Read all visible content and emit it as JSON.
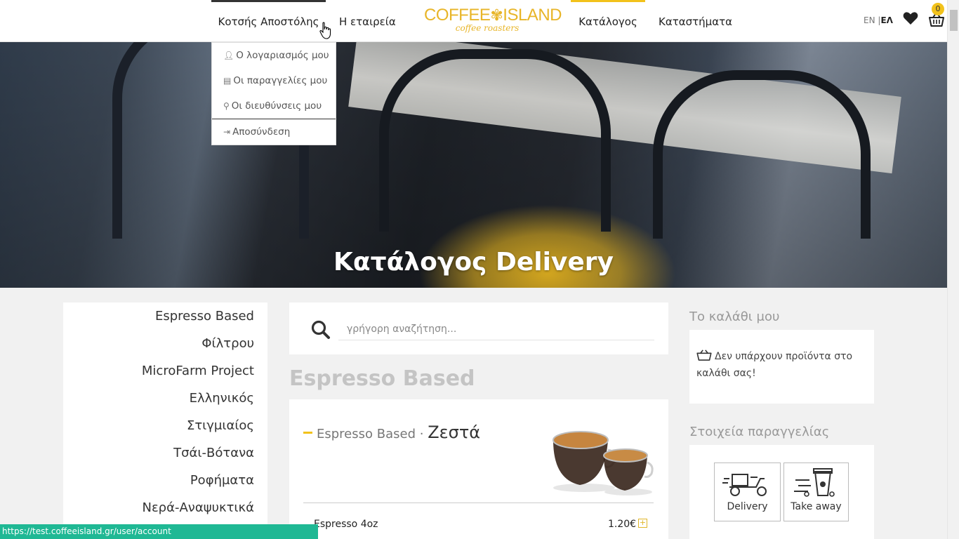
{
  "header": {
    "user_label": "Κοτσής Αποστόλης",
    "company_label": "Η εταιρεία",
    "catalog_label": "Κατάλογος",
    "stores_label": "Καταστήματα",
    "logo_brand_left": "COFFEE",
    "logo_brand_right": "ISLAND",
    "logo_sub": "coffee roasters",
    "lang_en": "EN",
    "lang_sep": "|",
    "lang_el": "ΕΛ",
    "cart_count": "0",
    "accent_color": "#f2c21b"
  },
  "user_menu": {
    "items": [
      {
        "icon": "user-icon",
        "label": "Ο λογαριασμός μου"
      },
      {
        "icon": "document-icon",
        "label": "Οι παραγγελίες μου"
      },
      {
        "icon": "map-marker-icon",
        "label": "Οι διευθύνσεις μου"
      },
      {
        "icon": "sign-out-icon",
        "label": "Αποσύνδεση"
      }
    ]
  },
  "hero": {
    "title": "Κατάλογος Delivery"
  },
  "sidebar": {
    "categories": [
      "Espresso Based",
      "Φίλτρου",
      "MicroFarm Project",
      "Ελληνικός",
      "Στιγμιαίος",
      "Τσάι-Βότανα",
      "Ροφήματα",
      "Νερά-Αναψυκτικά"
    ]
  },
  "search": {
    "placeholder": "γρήγορη αναζήτηση..."
  },
  "section": {
    "title": "Espresso Based",
    "card_category": "Espresso Based",
    "card_sep": "·",
    "card_subcategory": "Ζεστά",
    "item_name": "Espresso 4oz",
    "item_price": "1.20€",
    "add_symbol": "+"
  },
  "cart_panel": {
    "title": "Το καλάθι μου",
    "empty_text": "Δεν υπάρχουν προϊόντα στο καλάθι σας!"
  },
  "order_panel": {
    "title": "Στοιχεία παραγγελίας",
    "delivery_label": "Delivery",
    "takeaway_label": "Take away"
  },
  "status_bar": {
    "url": "https://test.coffeeisland.gr/user/account",
    "color": "#1fb894"
  }
}
